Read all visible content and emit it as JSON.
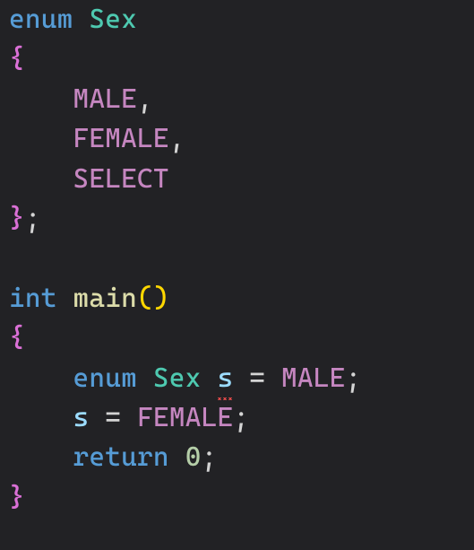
{
  "code": {
    "kw_enum": "enum",
    "type_sex": "Sex",
    "brace_open": "{",
    "brace_close": "}",
    "enum_male": "MALE",
    "enum_female": "FEMALE",
    "enum_select": "SELECT",
    "comma": ",",
    "semicolon": ";",
    "kw_int": "int",
    "fn_main": "main",
    "paren_open": "(",
    "paren_close": ")",
    "var_s": "s",
    "op_eq": "=",
    "kw_return": "return",
    "num_zero": "0"
  }
}
